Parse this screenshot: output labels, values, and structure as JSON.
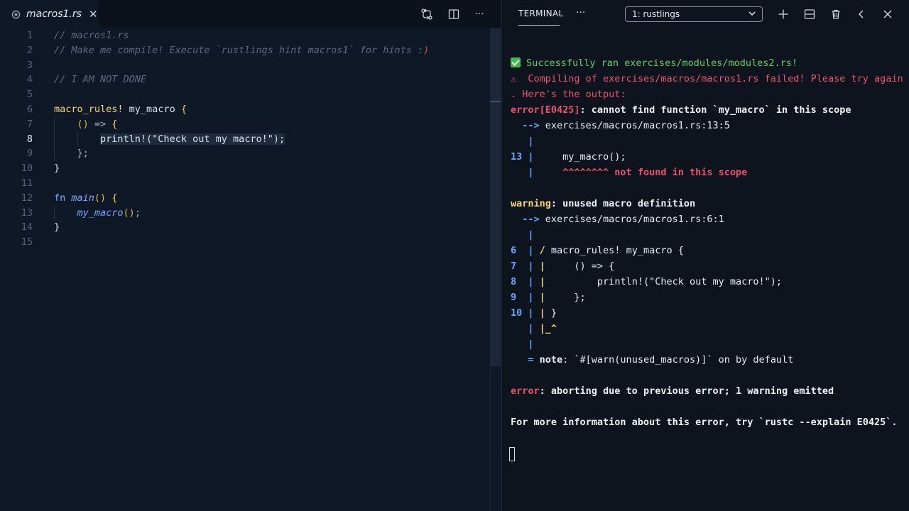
{
  "editor": {
    "tab": {
      "filename": "macros1.rs",
      "close_glyph": "✕"
    },
    "toolbar": {
      "more_glyph": "···"
    },
    "active_line": 8,
    "line_numbers": [
      "1",
      "2",
      "3",
      "4",
      "5",
      "6",
      "7",
      "8",
      "9",
      "10",
      "11",
      "12",
      "13",
      "14",
      "15"
    ],
    "code": {
      "l1": "// macros1.rs",
      "l2": "// Make me compile! Execute `rustlings hint macros1` for hints :",
      "l2_end": ")",
      "l4": "// I AM NOT DONE",
      "l6_kw": "macro_rules!",
      "l6_rest": " my_macro ",
      "l6_brace": "{",
      "l7_paren": "()",
      "l7_arrow": " => ",
      "l7_brace": "{",
      "l8_text": "println!(\"Check out my macro!\");",
      "l9": "};",
      "l10": "}",
      "l12_kw": "fn",
      "l12_name": "main",
      "l12_paren": "()",
      "l12_brace": "{",
      "l13_name": "my_macro",
      "l13_paren": "()",
      "l13_semi": ";",
      "l14": "}"
    }
  },
  "terminal": {
    "title": "TERMINAL",
    "more_glyph": "···",
    "selected_terminal": "1: rustlings",
    "lines": {
      "success": "Successfully ran exercises/modules/modules2.rs!",
      "warn_sign": "⚠",
      "compile_fail_1": "  Compiling of exercises/macros/macros1.rs failed! Please try again",
      "compile_fail_2": ". Here's the output:",
      "err_code": "error[E0425]",
      "err_msg": ": cannot find function `my_macro` in this scope",
      "arrow": "  -->",
      "err_loc": " exercises/macros/macros1.rs:13:5",
      "bar": "   |",
      "num13": "13 |",
      "call": "     my_macro();",
      "carets": "     ^^^^^^^^ not found in this scope",
      "warn_label": "warning",
      "warn_msg": ": unused macro definition",
      "warn_loc": " exercises/macros/macros1.rs:6:1",
      "w6_num": "6  |",
      "w6_mark": " /",
      "w6_text": " macro_rules! my_macro {",
      "w7_num": "7  |",
      "w7_mark": " |",
      "w7_text": "     () => {",
      "w8_num": "8  |",
      "w8_mark": " |",
      "w8_text": "         println!(\"Check out my macro!\");",
      "w9_num": "9  |",
      "w9_mark": " |",
      "w9_text": "     };",
      "w10_num": "10 |",
      "w10_mark": " |",
      "w10_text": " }",
      "wend_bar": "   |",
      "wend_mark": " |_^",
      "note_eq": "   = ",
      "note_label": "note",
      "note_msg": ": `#[warn(unused_macros)]` on by default",
      "abort_label": "error",
      "abort_msg": ": aborting due to previous error; 1 warning emitted",
      "more_info": "For more information about this error, try `rustc --explain E0425`."
    }
  }
}
